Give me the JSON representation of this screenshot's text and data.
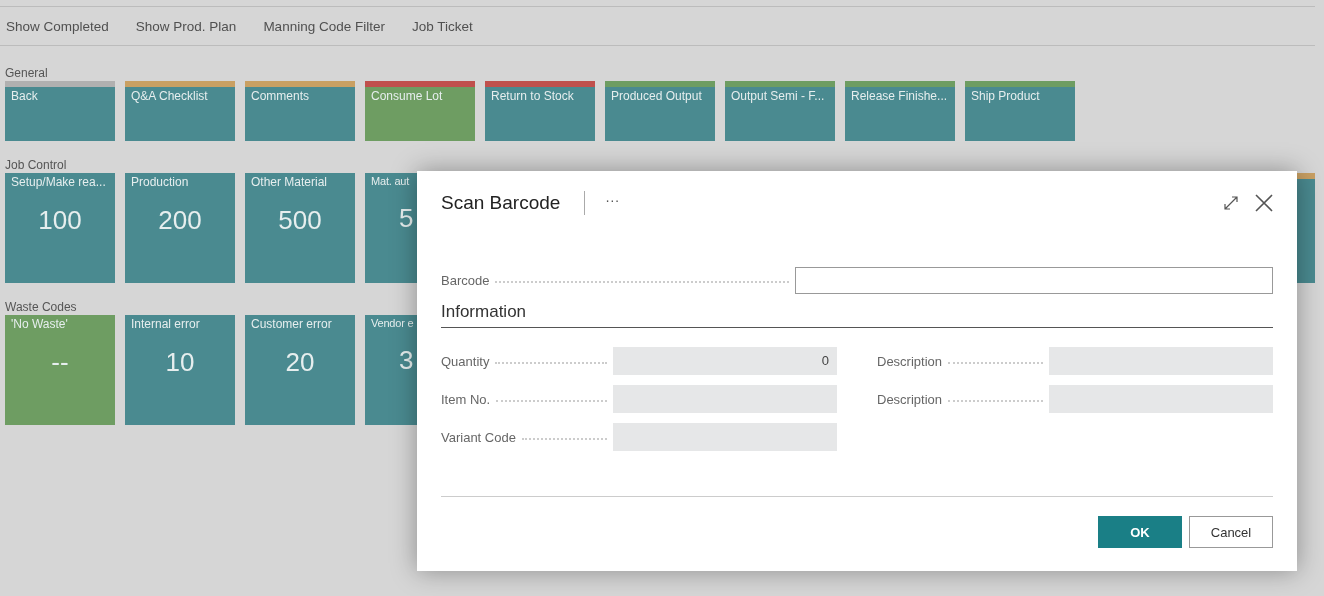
{
  "actions": [
    "Show Completed",
    "Show Prod. Plan",
    "Manning Code Filter",
    "Job Ticket"
  ],
  "groups": [
    {
      "title": "General",
      "tiles": [
        {
          "label": "Back",
          "kind": "standard",
          "color": "#b0b0b0"
        },
        {
          "label": "Q&A Checklist",
          "kind": "standard",
          "color": "#c9a063"
        },
        {
          "label": "Comments",
          "kind": "standard",
          "color": "#c9a063"
        },
        {
          "label": "Consume Lot",
          "kind": "highlight",
          "color": "#c0504d"
        },
        {
          "label": "Return to Stock",
          "kind": "standard",
          "color": "#c0504d"
        },
        {
          "label": "Produced Output",
          "kind": "standard",
          "color": "#6e9d62"
        },
        {
          "label": "Output Semi - F...",
          "kind": "standard",
          "color": "#6e9d62"
        },
        {
          "label": "Release Finishe...",
          "kind": "standard",
          "color": "#6e9d62"
        },
        {
          "label": "Ship Product",
          "kind": "standard",
          "color": "#6e9d62"
        }
      ]
    },
    {
      "title": "Job Control",
      "tiles": [
        {
          "label": "Setup/Make rea...",
          "value": "100",
          "kind": "standard"
        },
        {
          "label": "Production",
          "value": "200",
          "kind": "standard"
        },
        {
          "label": "Other Material",
          "value": "500",
          "kind": "standard"
        },
        {
          "label": "Mat. aut",
          "value": "5",
          "kind": "covered"
        },
        {
          "kind": "standard",
          "color": "#c9a063"
        }
      ]
    },
    {
      "title": "Waste Codes",
      "tiles": [
        {
          "label": "'No Waste'",
          "value": "--",
          "kind": "highlight"
        },
        {
          "label": "Internal error",
          "value": "10",
          "kind": "standard"
        },
        {
          "label": "Customer error",
          "value": "20",
          "kind": "standard"
        },
        {
          "label": "Vendor e",
          "value": "3",
          "kind": "covered"
        }
      ]
    }
  ],
  "dialog": {
    "title": "Scan Barcode",
    "more": "···",
    "barcode": {
      "label": "Barcode"
    },
    "section": "Information",
    "left_fields": [
      {
        "label": "Quantity",
        "value": "0"
      },
      {
        "label": "Item No."
      },
      {
        "label": "Variant Code"
      }
    ],
    "right_fields": [
      {
        "label": "Description"
      },
      {
        "label": "Description"
      }
    ],
    "buttons": [
      {
        "label": "OK",
        "kind": "primary"
      },
      {
        "label": "Cancel",
        "kind": "secondary"
      }
    ]
  }
}
